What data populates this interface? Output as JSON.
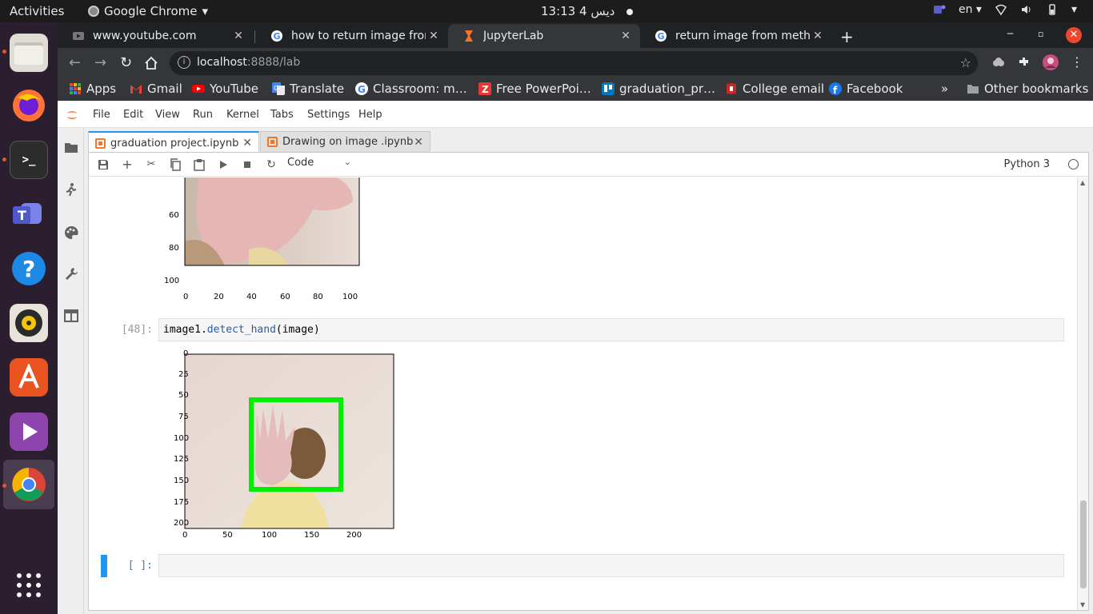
{
  "system": {
    "activities": "Activities",
    "app_name": "Google Chrome",
    "clock": "13:13",
    "clock_date": "4 ديس",
    "keyboard_layout": "en"
  },
  "dock": {
    "items": [
      "Files",
      "Firefox",
      "Terminal",
      "Microsoft Teams",
      "Help",
      "Rhythmbox",
      "Ubuntu Software",
      "Videos",
      "Google Chrome",
      "Show Applications"
    ]
  },
  "chrome": {
    "tabs": [
      {
        "title": "www.youtube.com",
        "close": "✕"
      },
      {
        "title": "how to return image from",
        "close": "✕"
      },
      {
        "title": "JupyterLab",
        "close": "✕"
      },
      {
        "title": "return image from metho",
        "close": "✕"
      }
    ],
    "new_tab": "+",
    "url_host": "localhost",
    "url_path": ":8888/lab",
    "bookmarks": [
      {
        "label": "Apps",
        "color": "#e8453c"
      },
      {
        "label": "Gmail",
        "color": "#ea4335"
      },
      {
        "label": "YouTube",
        "color": "#ff0000"
      },
      {
        "label": "Translate",
        "color": "#4285f4"
      },
      {
        "label": "Classroom: m…",
        "color": "#f1f3f4"
      },
      {
        "label": "Free PowerPoi…",
        "color": "#e53935"
      },
      {
        "label": "graduation_pr…",
        "color": "#0079bf"
      },
      {
        "label": "College email",
        "color": "#d32f2f"
      },
      {
        "label": "Facebook",
        "color": "#1877f2"
      }
    ],
    "bookmarks_overflow": "»",
    "other_bookmarks": "Other bookmarks"
  },
  "jupyter": {
    "menu": [
      "File",
      "Edit",
      "View",
      "Run",
      "Kernel",
      "Tabs",
      "Settings",
      "Help"
    ],
    "tabs": [
      {
        "title": "graduation project.ipynb",
        "close": "✕"
      },
      {
        "title": "Drawing on image .ipynb",
        "close": "✕"
      }
    ],
    "cell_type": "Code",
    "kernel_name": "Python 3",
    "cells": [
      {
        "prompt": "[48]:",
        "code_obj": "image1.",
        "code_fn": "detect_hand",
        "code_args": "(image)"
      },
      {
        "prompt": "[ ]:",
        "code": ""
      }
    ],
    "figure1": {
      "yticks": [
        "60",
        "80",
        "100"
      ],
      "xticks": [
        "0",
        "20",
        "40",
        "60",
        "80",
        "100"
      ]
    },
    "figure2": {
      "yticks": [
        "0",
        "25",
        "50",
        "75",
        "100",
        "125",
        "150",
        "175",
        "200"
      ],
      "xticks": [
        "0",
        "50",
        "100",
        "150",
        "200"
      ],
      "box_color": "#00ee00"
    }
  }
}
